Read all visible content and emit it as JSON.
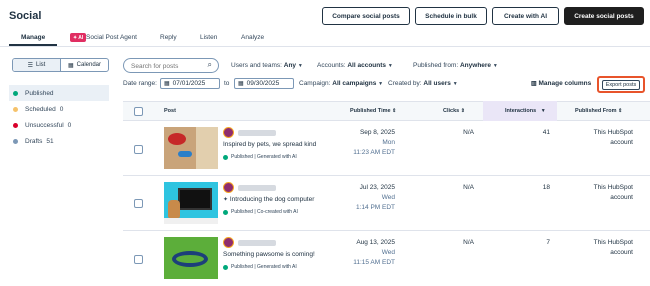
{
  "header": {
    "title": "Social"
  },
  "top_buttons": {
    "compare": "Compare social posts",
    "schedule": "Schedule in bulk",
    "create_ai": "Create with AI",
    "create": "Create social posts"
  },
  "tabs": [
    {
      "label": "Manage"
    },
    {
      "label": "Social Post Agent",
      "badge": "AI"
    },
    {
      "label": "Reply"
    },
    {
      "label": "Listen"
    },
    {
      "label": "Analyze"
    }
  ],
  "view_toggle": {
    "list": "List",
    "calendar": "Calendar"
  },
  "search": {
    "placeholder": "Search for posts"
  },
  "filters": {
    "users_label": "Users and teams:",
    "users_value": "Any",
    "accounts_label": "Accounts:",
    "accounts_value": "All accounts",
    "published_label": "Published from:",
    "published_value": "Anywhere",
    "date_label": "Date range:",
    "date_from": "07/01/2025",
    "date_to_label": "to",
    "date_to": "09/30/2025",
    "campaign_label": "Campaign:",
    "campaign_value": "All campaigns",
    "created_label": "Created by:",
    "created_value": "All users",
    "manage_columns": "Manage columns",
    "export": "Export posts"
  },
  "sidebar": {
    "items": [
      {
        "label": "Published",
        "count": "",
        "color": "#00a87b"
      },
      {
        "label": "Scheduled",
        "count": "0",
        "color": "#f5c26b"
      },
      {
        "label": "Unsuccessful",
        "count": "0",
        "color": "#d9002b"
      },
      {
        "label": "Drafts",
        "count": "51",
        "color": "#7c98b6"
      }
    ]
  },
  "table": {
    "headers": {
      "post": "Post",
      "published_time": "Published Time",
      "clicks": "Clicks",
      "interactions": "Interactions",
      "published_from": "Published From"
    },
    "rows": [
      {
        "text": "Inspired by pets, we spread kind",
        "status": "Published | Generated with AI",
        "date": "Sep 8, 2025",
        "day": "Mon",
        "time": "11:23 AM EDT",
        "clicks": "N/A",
        "interactions": "41",
        "from_1": "This HubSpot",
        "from_2": "account",
        "icon": ""
      },
      {
        "text": "Introducing the dog computer",
        "status": "Published | Co-created with AI",
        "date": "Jul 23, 2025",
        "day": "Wed",
        "time": "1:14 PM EDT",
        "clicks": "N/A",
        "interactions": "18",
        "from_1": "This HubSpot",
        "from_2": "account",
        "icon": "sparkle-icon"
      },
      {
        "text": "Something pawsome is coming!",
        "status": "Published | Generated with AI",
        "date": "Aug 13, 2025",
        "day": "Wed",
        "time": "11:15 AM EDT",
        "clicks": "N/A",
        "interactions": "7",
        "from_1": "This HubSpot",
        "from_2": "account",
        "icon": ""
      }
    ]
  },
  "colors": {
    "accent": "#ff5c35",
    "export_outline": "#e8542b",
    "sort_col_bg": "#eae6f7",
    "badge": "#e02e62"
  }
}
